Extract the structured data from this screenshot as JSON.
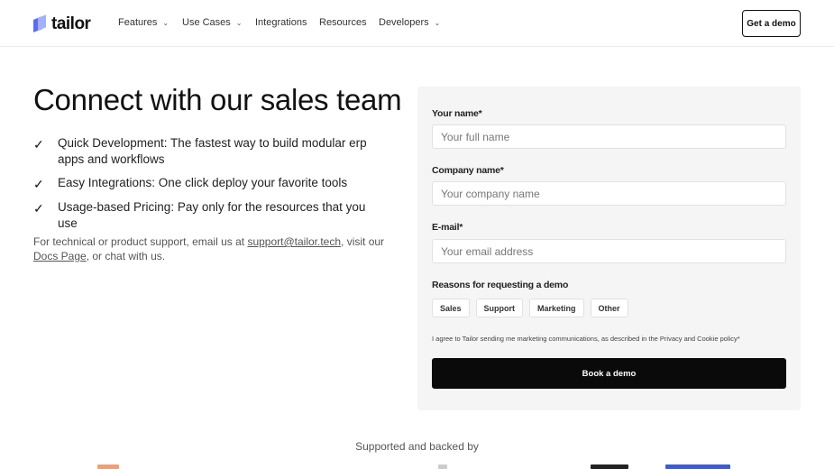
{
  "nav": {
    "brand": "tailor",
    "items": [
      {
        "label": "Features",
        "dropdown": true
      },
      {
        "label": "Use Cases",
        "dropdown": true
      },
      {
        "label": "Integrations",
        "dropdown": false
      },
      {
        "label": "Resources",
        "dropdown": false
      },
      {
        "label": "Developers",
        "dropdown": true
      }
    ],
    "cta": "Get a demo"
  },
  "hero": {
    "title": "Connect with our sales team",
    "bullets": [
      "Quick Development: The fastest way to build modular erp apps and workflows",
      "Easy Integrations: One click deploy your favorite tools",
      "Usage-based Pricing: Pay only for the resources that you use"
    ],
    "contact": {
      "prefix": "For technical or product support, email us at ",
      "email": "support@tailor.tech",
      "middle": ", visit our ",
      "docs": "Docs Page",
      "suffix": ", or chat with us."
    }
  },
  "form": {
    "name_label": "Your name*",
    "name_placeholder": "Your full name",
    "company_label": "Company name*",
    "company_placeholder": "Your company name",
    "email_label": "E-mail*",
    "email_placeholder": "Your email address",
    "reasons_label": "Reasons for requesting a demo",
    "reasons": [
      "Sales",
      "Support",
      "Marketing",
      "Other"
    ],
    "consent": "I agree to Tailor sending me marketing communications, as described in the Privacy and Cookie policy*",
    "submit": "Book a demo"
  },
  "footer": {
    "supported": "Supported and backed by"
  },
  "colors": {
    "brand_primary": "#5c6cf0",
    "brand_secondary": "#a3b0ff",
    "button_bg": "#0a0a0a",
    "form_bg": "#f5f5f6"
  }
}
